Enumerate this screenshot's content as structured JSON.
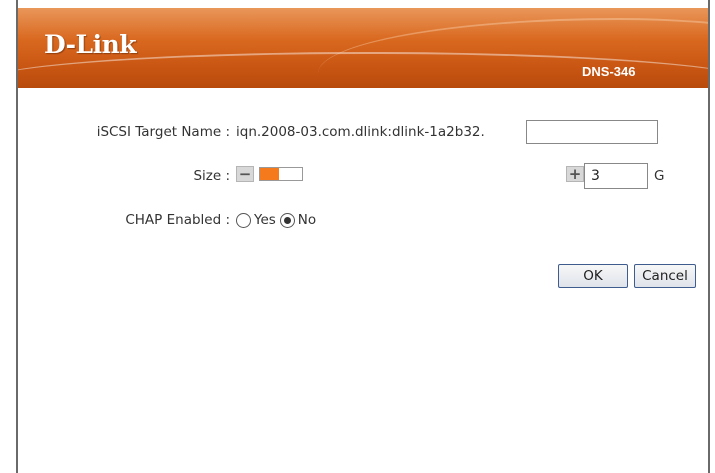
{
  "header": {
    "logo_text": "D-Link",
    "model": "DNS-346",
    "colors": {
      "header_orange": "#d9681f",
      "slider_fill": "#f47a1c"
    }
  },
  "form": {
    "target_name_label": "iSCSI Target Name :",
    "target_name_prefix": "iqn.2008-03.com.dlink:dlink-1a2b32.",
    "target_name_value": "",
    "size_label": "Size :",
    "size_slider_fraction": 0.45,
    "size_value": "3",
    "size_unit": "G",
    "minus_icon": "minus-icon",
    "plus_icon": "plus-icon",
    "chap_label": "CHAP Enabled :",
    "chap_options": [
      {
        "label": "Yes",
        "checked": false
      },
      {
        "label": "No",
        "checked": true
      }
    ]
  },
  "actions": {
    "ok_label": "OK",
    "cancel_label": "Cancel"
  }
}
